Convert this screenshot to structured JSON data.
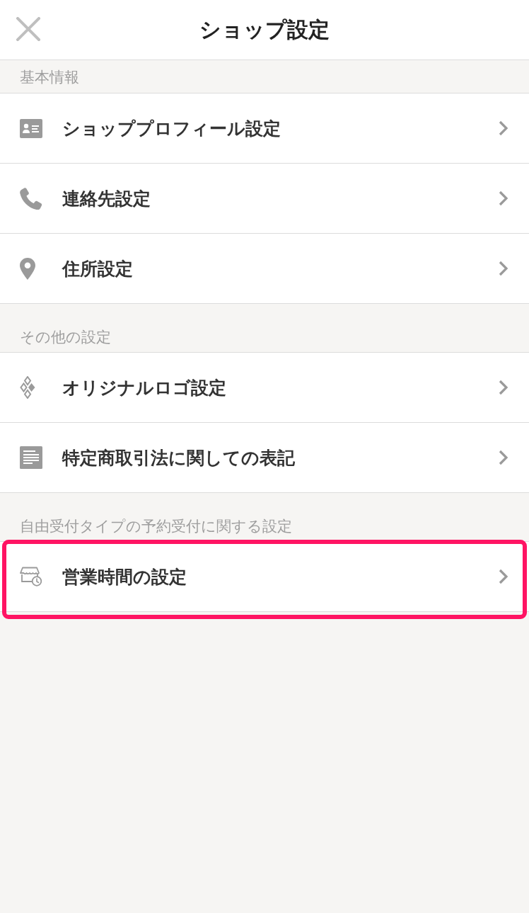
{
  "header": {
    "title": "ショップ設定"
  },
  "sections": [
    {
      "title": "基本情報",
      "items": [
        {
          "label": "ショッププロフィール設定",
          "kind": "profile",
          "highlighted": false
        },
        {
          "label": "連絡先設定",
          "kind": "phone",
          "highlighted": false
        },
        {
          "label": "住所設定",
          "kind": "address",
          "highlighted": false
        }
      ]
    },
    {
      "title": "その他の設定",
      "items": [
        {
          "label": "オリジナルロゴ設定",
          "kind": "logo",
          "highlighted": false
        },
        {
          "label": "特定商取引法に関しての表記",
          "kind": "document",
          "highlighted": false
        }
      ]
    },
    {
      "title": "自由受付タイプの予約受付に関する設定",
      "items": [
        {
          "label": "営業時間の設定",
          "kind": "hours",
          "highlighted": true
        }
      ]
    }
  ]
}
